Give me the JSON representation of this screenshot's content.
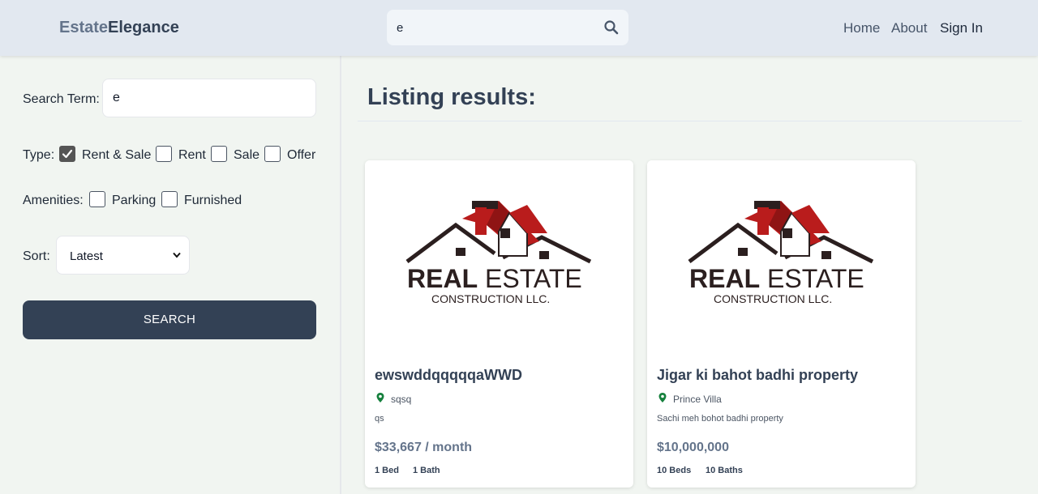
{
  "header": {
    "logo_part1": "Estate",
    "logo_part2": "Elegance",
    "search_value": "e",
    "nav": {
      "home": "Home",
      "about": "About",
      "signin": "Sign In"
    }
  },
  "sidebar": {
    "search_term_label": "Search Term:",
    "search_term_value": "e",
    "type_label": "Type:",
    "types": [
      {
        "label": "Rent & Sale",
        "checked": true
      },
      {
        "label": "Rent",
        "checked": false
      },
      {
        "label": "Sale",
        "checked": false
      },
      {
        "label": "Offer",
        "checked": false
      }
    ],
    "amenities_label": "Amenities:",
    "amenities": [
      {
        "label": "Parking",
        "checked": false
      },
      {
        "label": "Furnished",
        "checked": false
      }
    ],
    "sort_label": "Sort:",
    "sort_value": "Latest",
    "search_button": "SEARCH"
  },
  "main": {
    "title": "Listing results:",
    "logo_text": {
      "line1_bold": "REAL",
      "line1_rest": "ESTATE",
      "line2": "CONSTRUCTION LLC."
    },
    "listings": [
      {
        "title": "ewswddqqqqqaWWD",
        "address": "sqsq",
        "description": "qs",
        "price": "$33,667 / month",
        "beds": "1 Bed",
        "baths": "1 Bath"
      },
      {
        "title": "Jigar ki bahot badhi property",
        "address": "Prince Villa",
        "description": "Sachi meh bohot badhi property",
        "price": "$10,000,000",
        "beds": "10 Beds",
        "baths": "10 Baths"
      }
    ]
  },
  "colors": {
    "accent": "#334155",
    "logo_red": "#b91c1c",
    "pin_green": "#15803d"
  }
}
